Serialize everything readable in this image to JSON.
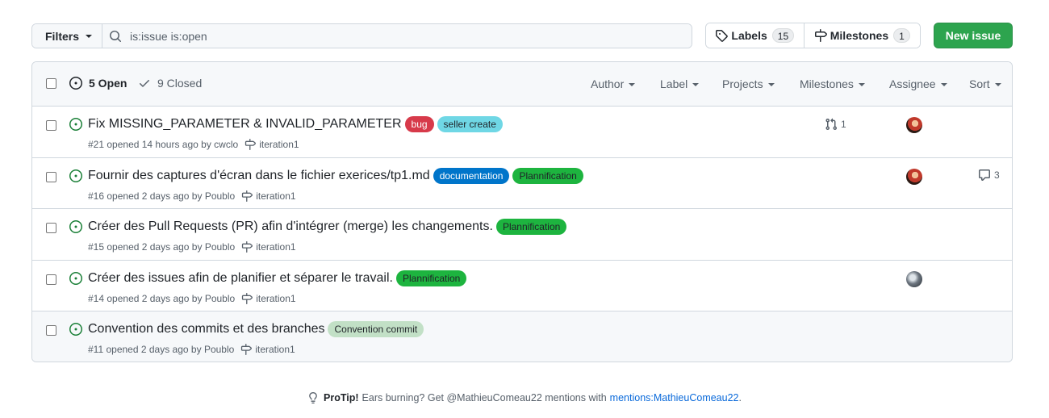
{
  "toolbar": {
    "filters_label": "Filters",
    "search_value": "is:issue is:open",
    "labels_label": "Labels",
    "labels_count": "15",
    "milestones_label": "Milestones",
    "milestones_count": "1",
    "new_issue_label": "New issue",
    "new_issue_color": "#2da44e"
  },
  "header": {
    "open_label": "5 Open",
    "closed_label": "9 Closed",
    "filters": [
      "Author",
      "Label",
      "Projects",
      "Milestones",
      "Assignee",
      "Sort"
    ]
  },
  "issues": [
    {
      "title": "Fix MISSING_PARAMETER & INVALID_PARAMETER",
      "labels": [
        {
          "name": "bug",
          "bg": "#d73a4a",
          "fg": "#ffffff"
        },
        {
          "name": "seller create",
          "bg": "#6fd7e5",
          "fg": "#1f2328"
        }
      ],
      "number": "#21",
      "opened": "opened 14 hours ago by",
      "author": "cwclo",
      "milestone": "iteration1",
      "linked_prs": "1",
      "assignee_avatar": "red",
      "comments": null
    },
    {
      "title": "Fournir des captures d'écran dans le fichier exerices/tp1.md",
      "labels": [
        {
          "name": "documentation",
          "bg": "#0075ca",
          "fg": "#ffffff"
        },
        {
          "name": "Plannification",
          "bg": "#1db43f",
          "fg": "#1f2328"
        }
      ],
      "number": "#16",
      "opened": "opened 2 days ago by",
      "author": "Poublo",
      "milestone": "iteration1",
      "linked_prs": null,
      "assignee_avatar": "red",
      "comments": "3"
    },
    {
      "title": "Créer des Pull Requests (PR) afin d'intégrer (merge) les changements.",
      "labels": [
        {
          "name": "Plannification",
          "bg": "#1db43f",
          "fg": "#1f2328"
        }
      ],
      "number": "#15",
      "opened": "opened 2 days ago by",
      "author": "Poublo",
      "milestone": "iteration1",
      "linked_prs": null,
      "assignee_avatar": null,
      "comments": null
    },
    {
      "title": "Créer des issues afin de planifier et séparer le travail.",
      "labels": [
        {
          "name": "Plannification",
          "bg": "#1db43f",
          "fg": "#1f2328"
        }
      ],
      "number": "#14",
      "opened": "opened 2 days ago by",
      "author": "Poublo",
      "milestone": "iteration1",
      "linked_prs": null,
      "assignee_avatar": "gray",
      "comments": null
    },
    {
      "title": "Convention des commits et des branches",
      "labels": [
        {
          "name": "Convention commit",
          "bg": "#c2e0c6",
          "fg": "#1f2328"
        }
      ],
      "number": "#11",
      "opened": "opened 2 days ago by",
      "author": "Poublo",
      "milestone": "iteration1",
      "linked_prs": null,
      "assignee_avatar": null,
      "comments": null
    }
  ],
  "protip": {
    "label": "ProTip!",
    "text": "Ears burning? Get @MathieuComeau22 mentions with",
    "link": "mentions:MathieuComeau22",
    "suffix": "."
  },
  "icons": {
    "search": "search-icon",
    "tag": "tag-icon",
    "milestone": "milestone-icon",
    "issue_open": "issue-opened-icon",
    "check": "check-icon",
    "pull_request": "git-pull-request-icon",
    "comment": "comment-icon",
    "light_bulb": "light-bulb-icon"
  },
  "colors": {
    "open_icon": "#1a7f37",
    "link": "#0969da",
    "muted": "#57606a"
  }
}
